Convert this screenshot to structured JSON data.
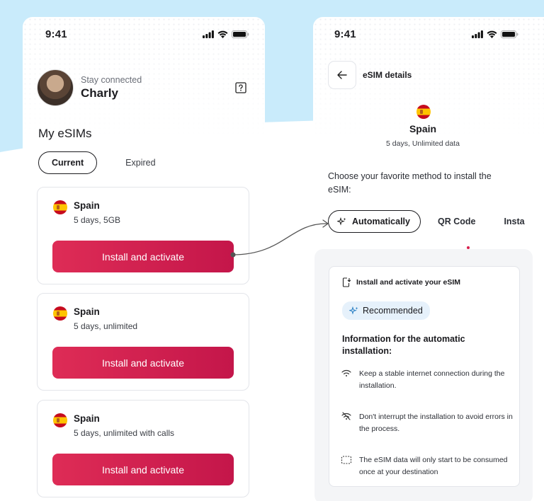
{
  "colors": {
    "accent": "#d42052",
    "background_blue": "#c9ebfb",
    "badge_bg": "#e6f1fb"
  },
  "left_screen": {
    "status_time": "9:41",
    "status_icons": [
      "signal-icon",
      "wifi-icon",
      "battery-icon"
    ],
    "greeting": "Stay connected",
    "user_name": "Charly",
    "help_icon": "help-icon",
    "section_title": "My eSIMs",
    "tabs": [
      {
        "label": "Current",
        "selected": true
      },
      {
        "label": "Expired",
        "selected": false
      }
    ],
    "cards": [
      {
        "country": "Spain",
        "plan": "5 days, 5GB",
        "button": "Install and activate",
        "flag": "spain-flag-icon"
      },
      {
        "country": "Spain",
        "plan": "5 days, unlimited",
        "button": "Install and activate",
        "flag": "spain-flag-icon"
      },
      {
        "country": "Spain",
        "plan": "5 days, unlimited with calls",
        "button": "Install and activate",
        "flag": "spain-flag-icon"
      }
    ]
  },
  "right_screen": {
    "status_time": "9:41",
    "status_icons": [
      "signal-icon",
      "wifi-icon",
      "battery-icon"
    ],
    "back_icon": "arrow-left-icon",
    "title": "eSIM details",
    "country": "Spain",
    "plan": "5 days, Unlimited data",
    "instruction": "Choose your favorite method to install the eSIM:",
    "method_tabs": [
      {
        "label": "Automatically",
        "icon": "sparkle-icon",
        "selected": true
      },
      {
        "label": "QR Code",
        "selected": false
      },
      {
        "label": "Insta",
        "selected": false
      }
    ],
    "info_card": {
      "header": "Install and activate your eSIM",
      "header_icon": "phone-download-icon",
      "badge": "Recommended",
      "badge_icon": "sparkle-icon",
      "title": "Information for the automatic installation:",
      "items": [
        {
          "icon": "wifi-icon",
          "text": "Keep a stable internet connection during the installation."
        },
        {
          "icon": "wifi-off-icon",
          "text": "Don't interrupt the installation to avoid errors in the process."
        },
        {
          "icon": "sim-card-icon",
          "text": "The eSIM data will only start to be consumed once at your destination"
        }
      ]
    }
  }
}
